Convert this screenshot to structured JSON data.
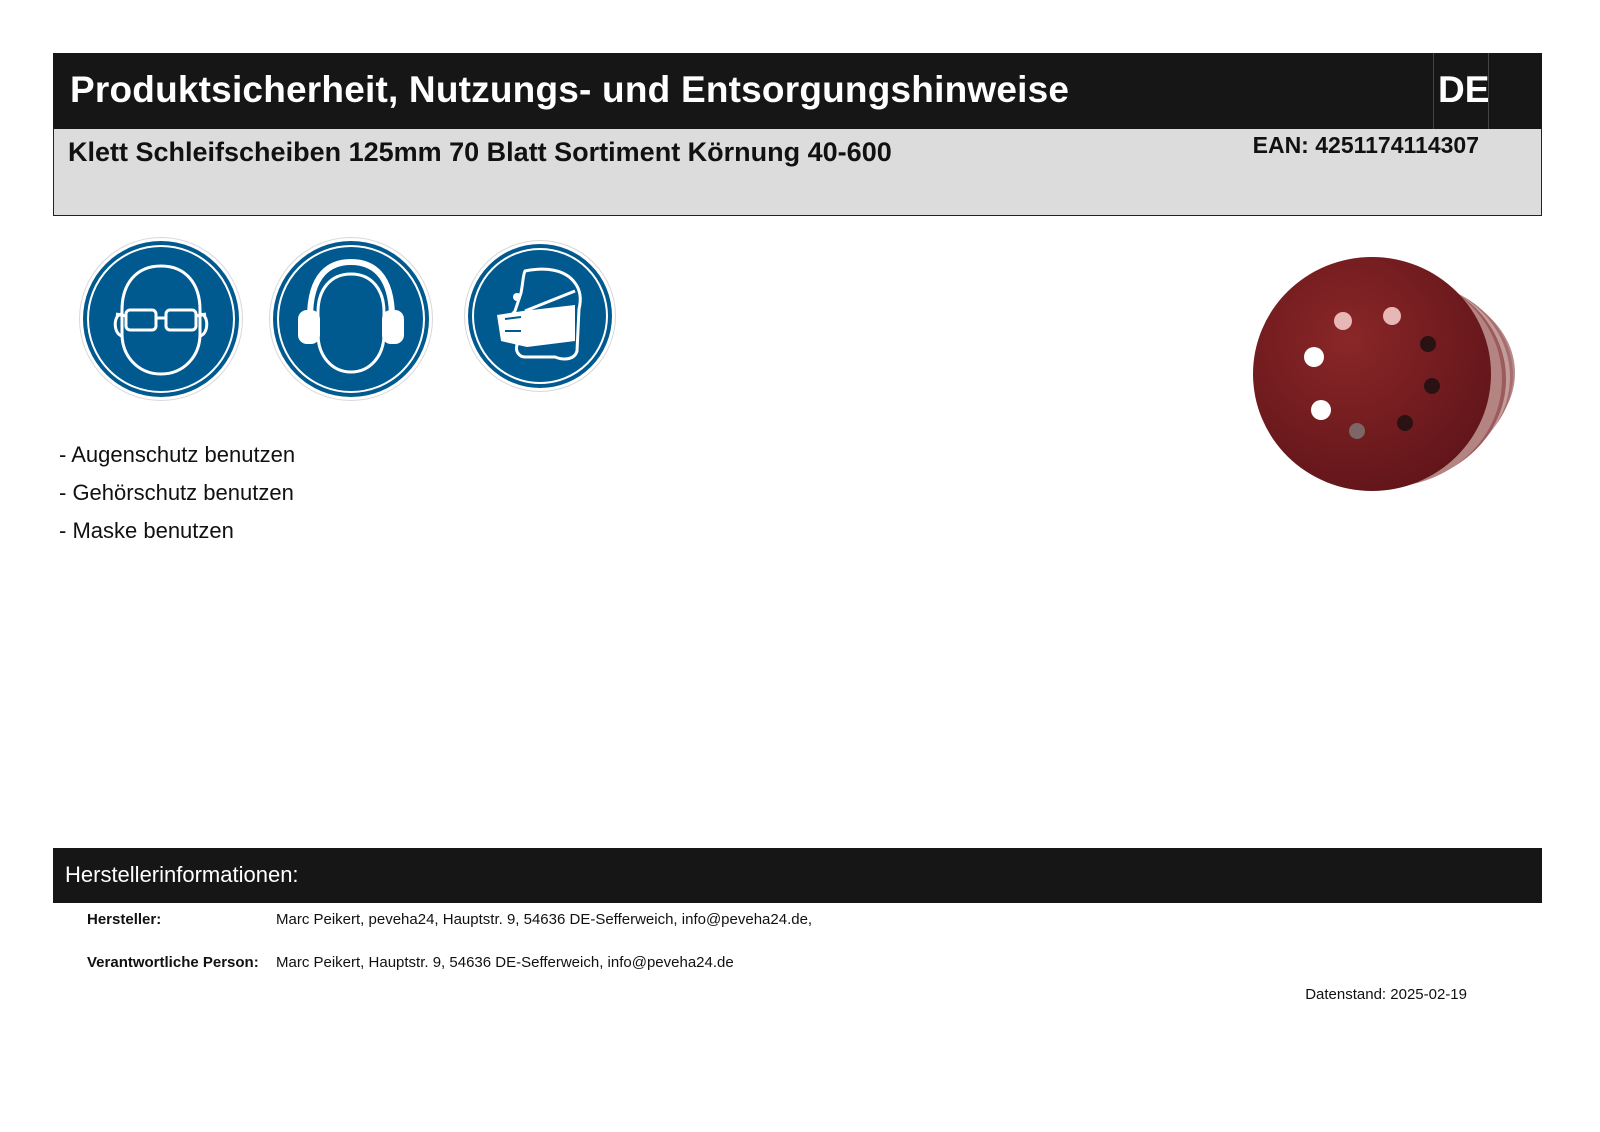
{
  "header": {
    "title": "Produktsicherheit, Nutzungs- und Entsorgungshinweise",
    "language": "DE"
  },
  "product": {
    "name": "Klett Schleifscheiben 125mm 70 Blatt Sortiment Körnung 40-600",
    "ean": "EAN: 4251174114307"
  },
  "safety_signs": [
    {
      "icon": "eye-protection-icon"
    },
    {
      "icon": "ear-protection-icon"
    },
    {
      "icon": "face-mask-icon"
    }
  ],
  "instructions": [
    "- Augenschutz benutzen",
    "- Gehörschutz benutzen",
    "- Maske benutzen"
  ],
  "product_image": {
    "icon": "sanding-disc-stack-icon",
    "color": "#7a1f22"
  },
  "manufacturer": {
    "section_title": "Herstellerinformationen:",
    "rows": [
      {
        "label": "Hersteller:",
        "value": "Marc Peikert, peveha24, Hauptstr. 9, 54636 DE-Sefferweich, info@peveha24.de,"
      },
      {
        "label": "Verantwortliche Person:",
        "value": "Marc Peikert, Hauptstr. 9, 54636 DE-Sefferweich, info@peveha24.de"
      }
    ]
  },
  "date_stamp": "Datenstand: 2025-02-19",
  "colors": {
    "sign_blue": "#005a8f",
    "header_bg": "#161616",
    "product_bg": "#dcdcdc"
  }
}
